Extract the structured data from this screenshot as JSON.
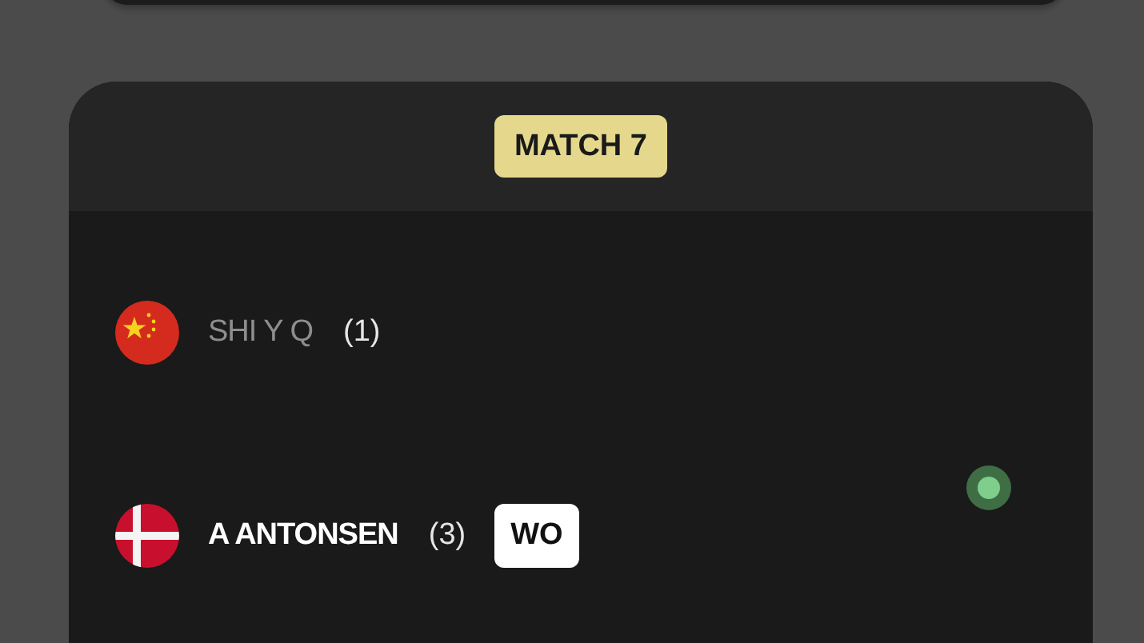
{
  "match": {
    "label": "MATCH 7",
    "players": [
      {
        "name": "SHI Y Q",
        "seed": "(1)",
        "kind": "china",
        "winner": false
      },
      {
        "name": "A ANTONSEN",
        "seed": "(3)",
        "kind": "denmark",
        "winner": true,
        "badge": "WO"
      }
    ],
    "live": true
  }
}
